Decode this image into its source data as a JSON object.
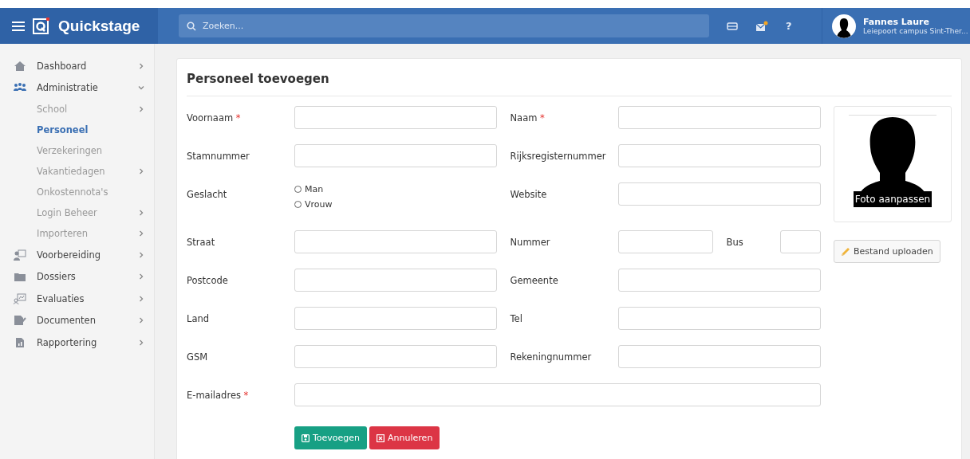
{
  "app": {
    "name": "Quickstage"
  },
  "search": {
    "placeholder": "Zoeken..."
  },
  "header": {
    "help": "?",
    "notification": true,
    "user": {
      "name": "Fannes Laure",
      "subtitle": "Leiepoort campus Sint-Ther..."
    }
  },
  "sidebar": {
    "items": [
      {
        "label": "Dashboard",
        "kind": "home",
        "submenu": true,
        "expanded": false
      },
      {
        "label": "Administratie",
        "kind": "people",
        "submenu": true,
        "expanded": true,
        "children": [
          {
            "label": "School",
            "submenu": true,
            "selected": false
          },
          {
            "label": "Personeel",
            "submenu": false,
            "selected": true
          },
          {
            "label": "Verzekeringen",
            "submenu": false,
            "selected": false
          },
          {
            "label": "Vakantiedagen",
            "submenu": true,
            "selected": false
          },
          {
            "label": "Onkostennota's",
            "submenu": false,
            "selected": false
          },
          {
            "label": "Login Beheer",
            "submenu": true,
            "selected": false
          },
          {
            "label": "Importeren",
            "submenu": true,
            "selected": false
          }
        ]
      },
      {
        "label": "Voorbereiding",
        "kind": "board",
        "submenu": true,
        "expanded": false
      },
      {
        "label": "Dossiers",
        "kind": "folder",
        "submenu": true,
        "expanded": false
      },
      {
        "label": "Evaluaties",
        "kind": "chart",
        "submenu": true,
        "expanded": false
      },
      {
        "label": "Documenten",
        "kind": "doc",
        "submenu": true,
        "expanded": false
      },
      {
        "label": "Rapportering",
        "kind": "report",
        "submenu": true,
        "expanded": false
      }
    ]
  },
  "form": {
    "title": "Personeel toevoegen",
    "rows": [
      [
        {
          "kind": "text",
          "label": "Voornaam",
          "marker": "*"
        },
        {
          "kind": "text",
          "label": "Naam",
          "marker": "*"
        }
      ],
      [
        {
          "kind": "text",
          "label": "Stamnummer"
        },
        {
          "kind": "text",
          "label": "Rijksregisternummer"
        }
      ],
      [
        {
          "kind": "radio",
          "label": "Geslacht",
          "options": [
            {
              "label": "Man",
              "selected": false
            },
            {
              "label": "Vrouw",
              "selected": false
            }
          ]
        },
        {
          "kind": "text",
          "label": "Website"
        }
      ],
      [
        {
          "kind": "text",
          "label": "Straat"
        },
        {
          "kind": "split",
          "label": "Nummer",
          "extra": "Bus"
        }
      ],
      [
        {
          "kind": "text",
          "label": "Postcode"
        },
        {
          "kind": "text",
          "label": "Gemeente"
        }
      ],
      [
        {
          "kind": "text",
          "label": "Land"
        },
        {
          "kind": "text",
          "label": "Tel"
        }
      ],
      [
        {
          "kind": "text",
          "label": "GSM"
        },
        {
          "kind": "text",
          "label": "Rekeningnummer"
        }
      ],
      [
        {
          "kind": "wide",
          "label": "E-mailadres",
          "marker": "*"
        }
      ]
    ],
    "buttons": [
      {
        "kind": "primary",
        "label": "Toevoegen"
      },
      {
        "kind": "danger",
        "label": "Annuleren"
      }
    ],
    "photo": {
      "caption": "Foto aanpassen",
      "upload": "Bestand uploaden"
    }
  }
}
